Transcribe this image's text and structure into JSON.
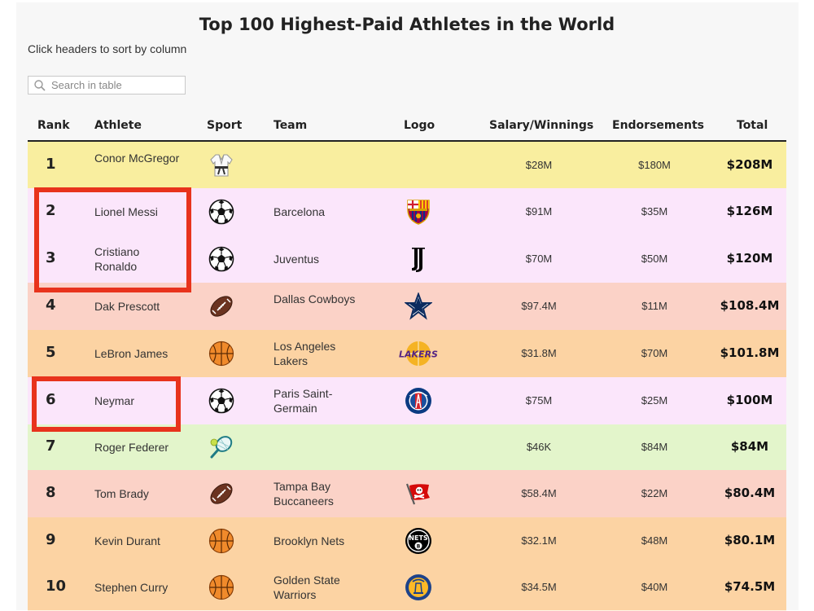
{
  "title": "Top 100 Highest-Paid Athletes in the World",
  "hint": "Click headers to sort by column",
  "search": {
    "placeholder": "Search in table"
  },
  "headers": {
    "rank": "Rank",
    "athlete": "Athlete",
    "sport": "Sport",
    "team": "Team",
    "logo": "Logo",
    "salary": "Salary/Winnings",
    "endorsements": "Endorsements",
    "total": "Total"
  },
  "rows": [
    {
      "rank": "1",
      "athlete": "Conor McGregor",
      "sport": "martial-arts-gi-icon",
      "team": "",
      "logo": "",
      "salary": "$28M",
      "endorsements": "$180M",
      "total": "$208M",
      "color": "#f9ee9f"
    },
    {
      "rank": "2",
      "athlete": "Lionel Messi",
      "sport": "soccer-ball-icon",
      "team": "Barcelona",
      "logo": "barcelona-crest",
      "salary": "$91M",
      "endorsements": "$35M",
      "total": "$126M",
      "color": "#fbe6fb"
    },
    {
      "rank": "3",
      "athlete": "Cristiano Ronaldo",
      "sport": "soccer-ball-icon",
      "team": "Juventus",
      "logo": "juventus-logo",
      "salary": "$70M",
      "endorsements": "$50M",
      "total": "$120M",
      "color": "#fbe6fb"
    },
    {
      "rank": "4",
      "athlete": "Dak Prescott",
      "sport": "football-icon",
      "team": "Dallas Cowboys",
      "logo": "cowboys-star",
      "salary": "$97.4M",
      "endorsements": "$11M",
      "total": "$108.4M",
      "color": "#fbd2c7"
    },
    {
      "rank": "5",
      "athlete": "LeBron James",
      "sport": "basketball-icon",
      "team": "Los Angeles Lakers",
      "logo": "lakers-logo",
      "salary": "$31.8M",
      "endorsements": "$70M",
      "total": "$101.8M",
      "color": "#fcd3a3"
    },
    {
      "rank": "6",
      "athlete": "Neymar",
      "sport": "soccer-ball-icon",
      "team": "Paris Saint-Germain",
      "logo": "psg-crest",
      "salary": "$75M",
      "endorsements": "$25M",
      "total": "$100M",
      "color": "#fbe6fb"
    },
    {
      "rank": "7",
      "athlete": "Roger Federer",
      "sport": "tennis-racket-icon",
      "team": "",
      "logo": "",
      "salary": "$46K",
      "endorsements": "$84M",
      "total": "$84M",
      "color": "#e3f5cb"
    },
    {
      "rank": "8",
      "athlete": "Tom Brady",
      "sport": "football-icon",
      "team": "Tampa Bay Buccaneers",
      "logo": "buccaneers-flag",
      "salary": "$58.4M",
      "endorsements": "$22M",
      "total": "$80.4M",
      "color": "#fbd2c7"
    },
    {
      "rank": "9",
      "athlete": "Kevin Durant",
      "sport": "basketball-icon",
      "team": "Brooklyn Nets",
      "logo": "nets-logo",
      "salary": "$32.1M",
      "endorsements": "$48M",
      "total": "$80.1M",
      "color": "#fcd3a3"
    },
    {
      "rank": "10",
      "athlete": "Stephen Curry",
      "sport": "basketball-icon",
      "team": "Golden State Warriors",
      "logo": "warriors-logo",
      "salary": "$34.5M",
      "endorsements": "$40M",
      "total": "$74.5M",
      "color": "#fcd3a3"
    }
  ],
  "annotation_color": "#e8331c"
}
